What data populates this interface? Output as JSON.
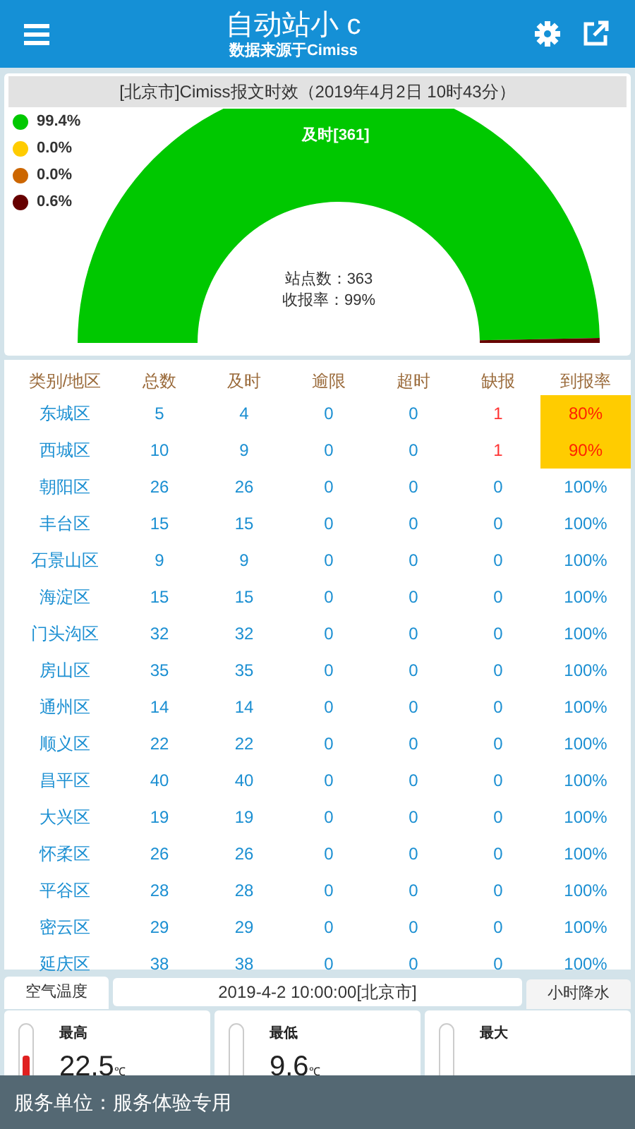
{
  "header": {
    "title": "自动站小 c",
    "subtitle": "数据来源于Cimiss"
  },
  "gauge": {
    "title": "[北京市]Cimiss报文时效（2019年4月2日 10时43分）",
    "legend": [
      {
        "color": "#00c800",
        "label": "99.4%"
      },
      {
        "color": "#ffcc00",
        "label": "0.0%"
      },
      {
        "color": "#cc6600",
        "label": "0.0%"
      },
      {
        "color": "#660000",
        "label": "0.6%"
      }
    ],
    "slice_label": "及时[361]",
    "station_count": "站点数：363",
    "receive_rate": "收报率：99%",
    "chart_data": {
      "type": "donut",
      "values": [
        99.4,
        0,
        0,
        0.6
      ]
    }
  },
  "table": {
    "columns": [
      "类别/地区",
      "总数",
      "及时",
      "逾限",
      "超时",
      "缺报",
      "到报率"
    ],
    "rows": [
      {
        "cells": [
          "东城区",
          "5",
          "4",
          "0",
          "0",
          "1",
          "80%"
        ],
        "warning": true
      },
      {
        "cells": [
          "西城区",
          "10",
          "9",
          "0",
          "0",
          "1",
          "90%"
        ],
        "warning": true
      },
      {
        "cells": [
          "朝阳区",
          "26",
          "26",
          "0",
          "0",
          "0",
          "100%"
        ],
        "warning": false
      },
      {
        "cells": [
          "丰台区",
          "15",
          "15",
          "0",
          "0",
          "0",
          "100%"
        ],
        "warning": false
      },
      {
        "cells": [
          "石景山区",
          "9",
          "9",
          "0",
          "0",
          "0",
          "100%"
        ],
        "warning": false
      },
      {
        "cells": [
          "海淀区",
          "15",
          "15",
          "0",
          "0",
          "0",
          "100%"
        ],
        "warning": false
      },
      {
        "cells": [
          "门头沟区",
          "32",
          "32",
          "0",
          "0",
          "0",
          "100%"
        ],
        "warning": false
      },
      {
        "cells": [
          "房山区",
          "35",
          "35",
          "0",
          "0",
          "0",
          "100%"
        ],
        "warning": false
      },
      {
        "cells": [
          "通州区",
          "14",
          "14",
          "0",
          "0",
          "0",
          "100%"
        ],
        "warning": false
      },
      {
        "cells": [
          "顺义区",
          "22",
          "22",
          "0",
          "0",
          "0",
          "100%"
        ],
        "warning": false
      },
      {
        "cells": [
          "昌平区",
          "40",
          "40",
          "0",
          "0",
          "0",
          "100%"
        ],
        "warning": false
      },
      {
        "cells": [
          "大兴区",
          "19",
          "19",
          "0",
          "0",
          "0",
          "100%"
        ],
        "warning": false
      },
      {
        "cells": [
          "怀柔区",
          "26",
          "26",
          "0",
          "0",
          "0",
          "100%"
        ],
        "warning": false
      },
      {
        "cells": [
          "平谷区",
          "28",
          "28",
          "0",
          "0",
          "0",
          "100%"
        ],
        "warning": false
      },
      {
        "cells": [
          "密云区",
          "29",
          "29",
          "0",
          "0",
          "0",
          "100%"
        ],
        "warning": false
      },
      {
        "cells": [
          "延庆区",
          "38",
          "38",
          "0",
          "0",
          "0",
          "100%"
        ],
        "warning": false
      }
    ]
  },
  "tabs": [
    {
      "label": "空气温度",
      "selected": true
    },
    {
      "label": "小时降水",
      "selected": false
    }
  ],
  "time_label": "2019-4-2 10:00:00[北京市]",
  "cards": [
    {
      "label": "最高",
      "value": "22.5",
      "unit": "℃",
      "level": 0.55
    },
    {
      "label": "最低",
      "value": "9.6",
      "unit": "℃"
    },
    {
      "label": "最大"
    }
  ],
  "footer": "服务单位：服务体验专用"
}
